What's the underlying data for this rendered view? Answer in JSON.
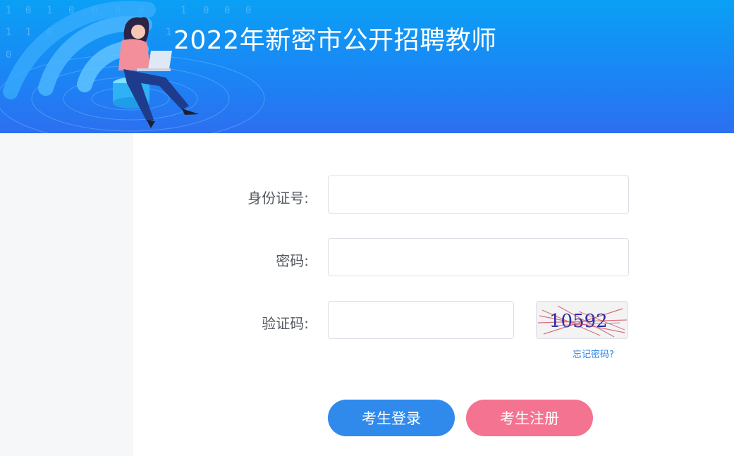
{
  "header": {
    "title": "2022年新密市公开招聘教师",
    "binary_digits": [
      "1",
      "0",
      "1",
      "0",
      "0",
      "0",
      "0",
      "1",
      "0",
      "0",
      "0",
      "1",
      "1",
      "0",
      "1",
      "0",
      "0",
      "0",
      "1",
      "0"
    ]
  },
  "form": {
    "id_label": "身份证号:",
    "id_value": "",
    "password_label": "密码:",
    "password_value": "",
    "captcha_label": "验证码:",
    "captcha_value": "",
    "captcha_image_text": "10592",
    "forgot_link": "忘记密码?"
  },
  "buttons": {
    "login": "考生登录",
    "register": "考生注册"
  },
  "colors": {
    "header_top": "#0aa0f5",
    "header_bottom": "#2c6ff0",
    "login_button": "#2f8aec",
    "register_button": "#f47391",
    "link": "#2f83e6"
  }
}
